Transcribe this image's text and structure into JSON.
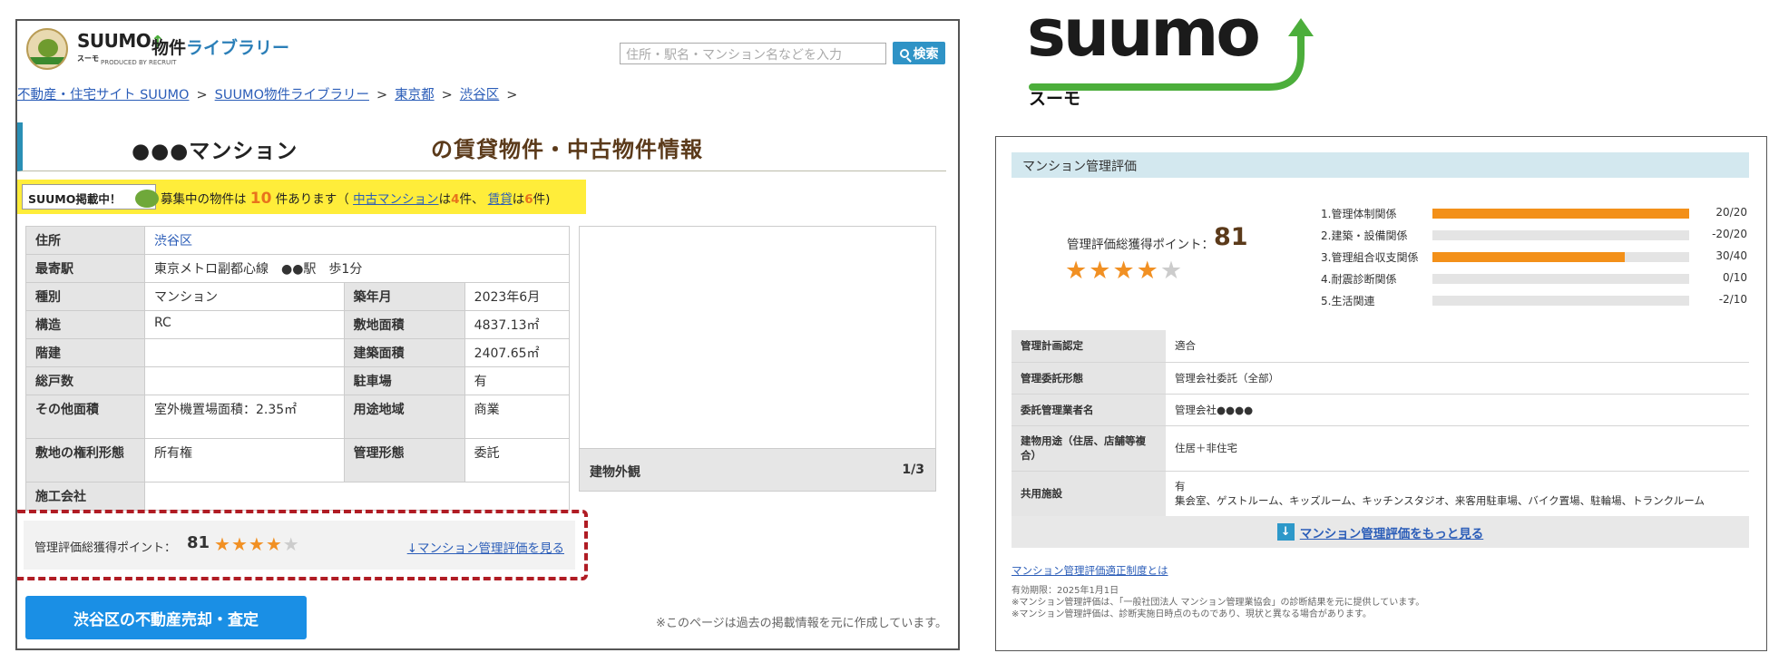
{
  "left": {
    "header": {
      "brand": "SUUMO",
      "brand_kana": "スーモ",
      "produced_by": "PRODUCED BY RECRUIT",
      "library_prefix": "物件",
      "library_title": "ライブラリー",
      "search_placeholder": "住所・駅名・マンション名などを入力",
      "search_button": "検索"
    },
    "breadcrumb": {
      "items": [
        "不動産・住宅サイト SUUMO",
        "SUUMO物件ライブラリー",
        "東京都",
        "渋谷区"
      ],
      "separator": ">"
    },
    "title": {
      "name": "●●●マンション",
      "suffix": "の賃貸物件・中古物件情報"
    },
    "notice": {
      "badge": "SUUMO掲載中！",
      "prefix": "募集中の物件は",
      "count": "10",
      "mid": "件あります（",
      "used_link": "中古マンション",
      "used_ha": "は",
      "used_count": "4",
      "used_ken": "件、",
      "rent_link": "賃貸",
      "rent_ha": "は",
      "rent_count": "6",
      "rent_ken": "件)"
    },
    "table": {
      "address_label": "住所",
      "address_value": "渋谷区",
      "station_label": "最寄駅",
      "station_value": "東京メトロ副都心線　●●駅　歩1分",
      "type_label": "種別",
      "type_value": "マンション",
      "built_label": "築年月",
      "built_value": "2023年6月",
      "structure_label": "構造",
      "structure_value": "RC",
      "site_area_label": "敷地面積",
      "site_area_value": "4837.13㎡",
      "floors_label": "階建",
      "floors_value": "",
      "building_area_label": "建築面積",
      "building_area_value": "2407.65㎡",
      "units_label": "総戸数",
      "units_value": "",
      "parking_label": "駐車場",
      "parking_value": "有",
      "other_area_label": "その他面積",
      "other_area_value": "室外機置場面積：2.35㎡",
      "zoning_label": "用途地域",
      "zoning_value": "商業",
      "land_rights_label": "敷地の権利形態",
      "land_rights_value": "所有権",
      "mgmt_form_label": "管理形態",
      "mgmt_form_value": "委託",
      "builder_label": "施工会社",
      "builder_value": ""
    },
    "photo": {
      "label": "建物外観",
      "counter": "1/3"
    },
    "eval": {
      "label": "管理評価総獲得ポイント：",
      "score": "81",
      "stars_filled": 4,
      "stars_total": 5,
      "link": "↓マンション管理評価を見る"
    },
    "sell_button": "渋谷区の不動産売却・査定",
    "footnote": "※このページは過去の掲載情報を元に作成しています。"
  },
  "big_logo": {
    "word": "suumo",
    "kana": "スーモ"
  },
  "right": {
    "heading": "マンション管理評価",
    "total_label": "管理評価総獲得ポイント：",
    "total_score": "81",
    "stars_filled": 4,
    "stars_total": 5,
    "items": [
      {
        "name": "1.管理体制関係",
        "value": "20/20",
        "fraction": 1.0
      },
      {
        "name": "2.建築・設備関係",
        "value": "-20/20",
        "fraction": 0.0
      },
      {
        "name": "3.管理組合収支関係",
        "value": "30/40",
        "fraction": 0.75
      },
      {
        "name": "4.耐震診断関係",
        "value": "0/10",
        "fraction": 0.0
      },
      {
        "name": "5.生活関連",
        "value": "-2/10",
        "fraction": 0.0
      }
    ],
    "rows": [
      {
        "key": "管理計画認定",
        "value": "適合",
        "value2": ""
      },
      {
        "key": "管理委託形態",
        "value": "管理会社委託（全部）",
        "value2": ""
      },
      {
        "key": "委託管理業者名",
        "value": "管理会社●●●●",
        "value2": ""
      },
      {
        "key": "建物用途（住居、店舗等複合）",
        "value": "住居＋非住宅",
        "value2": ""
      },
      {
        "key": "共用施設",
        "value": "有",
        "value2": "集会室、ゲストルーム、キッズルーム、キッチンスタジオ、来客用駐車場、バイク置場、駐輪場、トランクルーム"
      }
    ],
    "more_arrow": "↓",
    "more_link": "マンション管理評価をもっと見る",
    "cert_link": "マンション管理評価適正制度とは",
    "notes": [
      "有効期限：2025年1月1日",
      "※マンション管理評価は、「一般社団法人 マンション管理業協会」の診断結果を元に提供しています。",
      "※マンション管理評価は、診断実施日時点のものであり、現状と異なる場合があります。"
    ]
  },
  "colors": {
    "accent_blue": "#2a8fb5",
    "link_blue": "#2b5db8",
    "star_orange": "#f19023",
    "bar_orange": "#f39019",
    "notice_yellow": "#ffed3a",
    "dashed_red": "#b01c24",
    "logo_green": "#4cae3b"
  }
}
